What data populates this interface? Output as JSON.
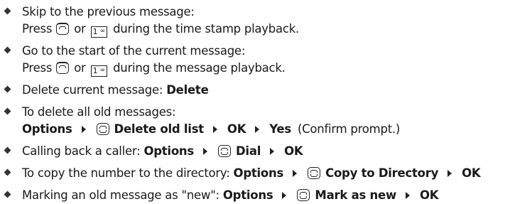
{
  "items": [
    {
      "l1": "Skip to the previous message:",
      "l2_pre": "Press",
      "l2_or": "or",
      "key_digit": "1",
      "key_symbol": "∞",
      "l2_post": "during the time stamp playback."
    },
    {
      "l1": "Go to the start of the current message:",
      "l2_pre": "Press",
      "l2_or": "or",
      "key_digit": "1",
      "key_symbol": "∞",
      "l2_post": "during the message playback."
    },
    {
      "text": "Delete current message:",
      "bold": "Delete"
    },
    {
      "l1": "To delete all old messages:",
      "options": "Options",
      "menu": "Delete old list",
      "ok": "OK",
      "yes": "Yes",
      "note": "(Confirm prompt.)"
    },
    {
      "text": "Calling back a caller:",
      "options": "Options",
      "menu": "Dial",
      "ok": "OK"
    },
    {
      "text": "To copy the number to the directory:",
      "options": "Options",
      "menu": "Copy to Directory",
      "ok": "OK"
    },
    {
      "text": "Marking an old message as \"new\":",
      "options": "Options",
      "menu": "Mark as new",
      "ok": "OK"
    }
  ],
  "icons": {
    "control_key": "control-key-icon",
    "control_key_up": "control-key-up-icon",
    "digit_key": "key-1-icon",
    "arrow": "menu-arrow-icon",
    "bullet": "diamond-bullet-icon"
  },
  "colors": {
    "text": "#1a1a1a",
    "bullet": "#333333"
  }
}
